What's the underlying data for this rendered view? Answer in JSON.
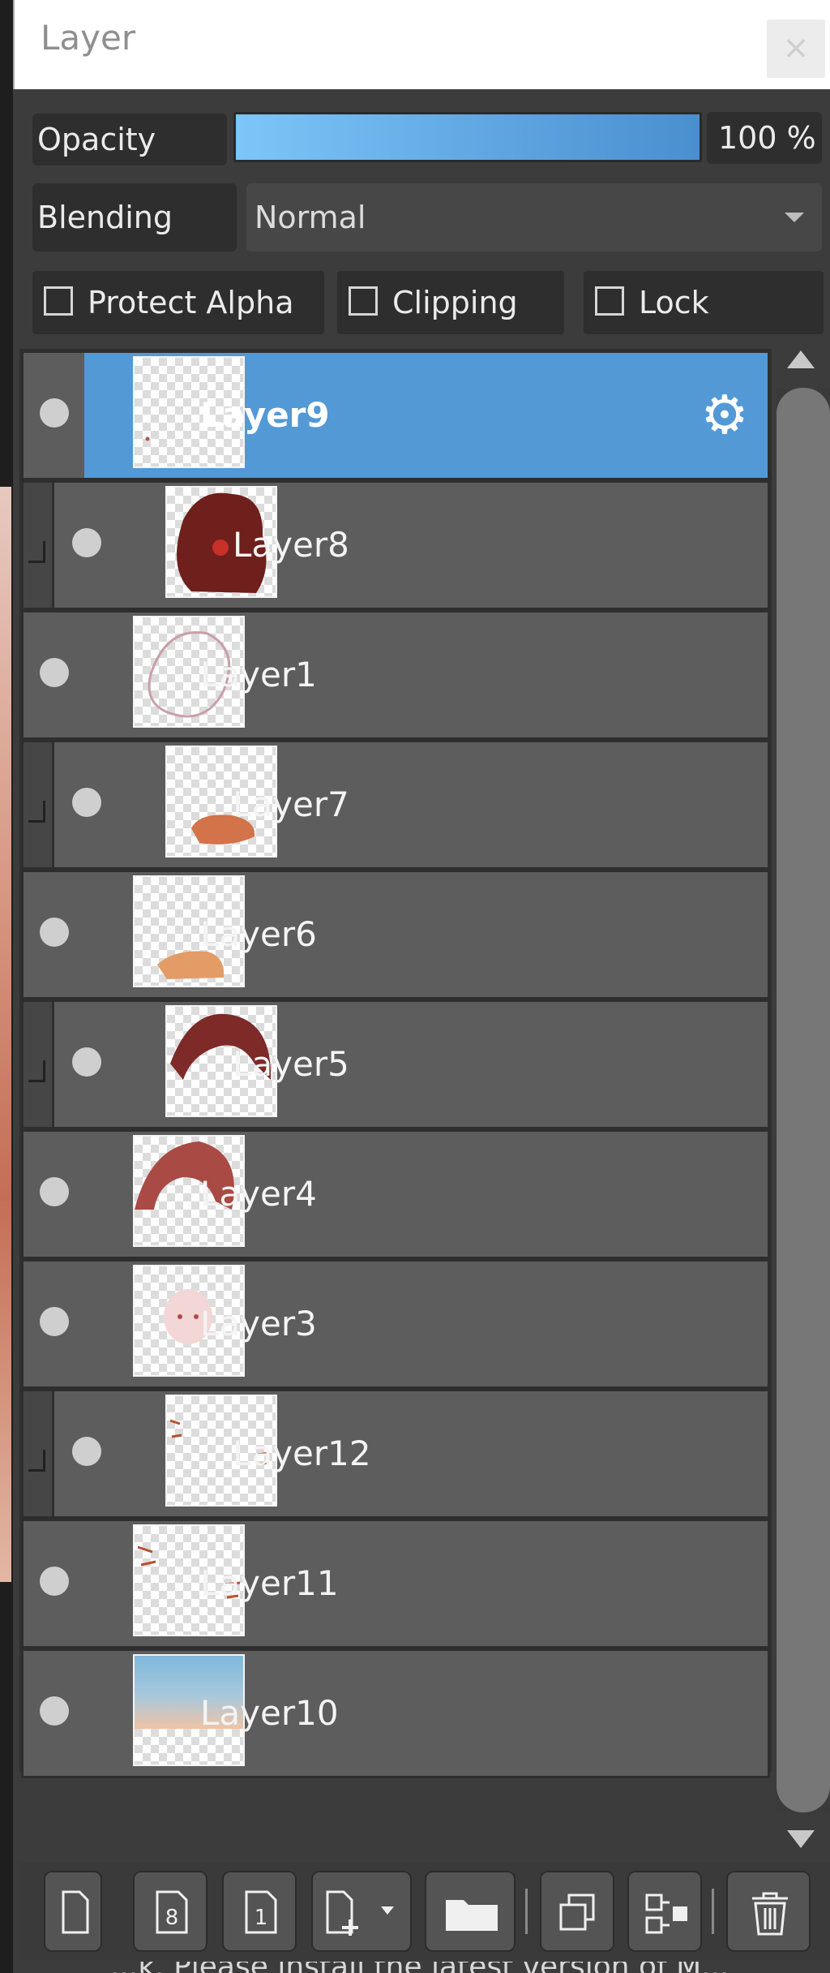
{
  "panel": {
    "title": "Layer",
    "close_label": "×"
  },
  "opacity": {
    "label": "Opacity",
    "value": "100 %",
    "level_percent": 100
  },
  "blending": {
    "label": "Blending",
    "value": "Normal"
  },
  "checkboxes": {
    "protect_alpha": {
      "label": "Protect Alpha",
      "checked": false
    },
    "clipping": {
      "label": "Clipping",
      "checked": false
    },
    "lock": {
      "label": "Lock",
      "checked": false
    }
  },
  "layers": [
    {
      "name": "Layer9",
      "selected": true,
      "clipped": false,
      "visible": true,
      "settings_icon": "gear-icon"
    },
    {
      "name": "Layer8",
      "selected": false,
      "clipped": true,
      "visible": true
    },
    {
      "name": "Layer1",
      "selected": false,
      "clipped": false,
      "visible": true
    },
    {
      "name": "Layer7",
      "selected": false,
      "clipped": true,
      "visible": true
    },
    {
      "name": "Layer6",
      "selected": false,
      "clipped": false,
      "visible": true
    },
    {
      "name": "Layer5",
      "selected": false,
      "clipped": true,
      "visible": true
    },
    {
      "name": "Layer4",
      "selected": false,
      "clipped": false,
      "visible": true
    },
    {
      "name": "Layer3",
      "selected": false,
      "clipped": false,
      "visible": true
    },
    {
      "name": "Layer12",
      "selected": false,
      "clipped": true,
      "visible": true
    },
    {
      "name": "Layer11",
      "selected": false,
      "clipped": false,
      "visible": true
    },
    {
      "name": "Layer10",
      "selected": false,
      "clipped": false,
      "visible": true
    }
  ],
  "toolbar": {
    "buttons": [
      {
        "name": "new-layer-button",
        "icon": "new-page-icon"
      },
      {
        "name": "new-8bit-layer-button",
        "icon": "page-8-icon",
        "glyph": "8"
      },
      {
        "name": "new-1bit-layer-button",
        "icon": "page-1-icon",
        "glyph": "1"
      },
      {
        "name": "add-layer-menu-button",
        "icon": "page-plus-dropdown-icon"
      },
      {
        "name": "new-folder-button",
        "icon": "folder-icon"
      },
      {
        "name": "duplicate-layer-button",
        "icon": "duplicate-icon"
      },
      {
        "name": "merge-layer-button",
        "icon": "merge-down-icon"
      },
      {
        "name": "delete-layer-button",
        "icon": "trash-icon"
      }
    ]
  },
  "footer": {
    "text": "...k. Please install the latest version of M..."
  },
  "colors": {
    "selected_row": "#5299d6",
    "row_bg": "#5d5d5d",
    "opacity_bar": "#5fa6e2"
  }
}
